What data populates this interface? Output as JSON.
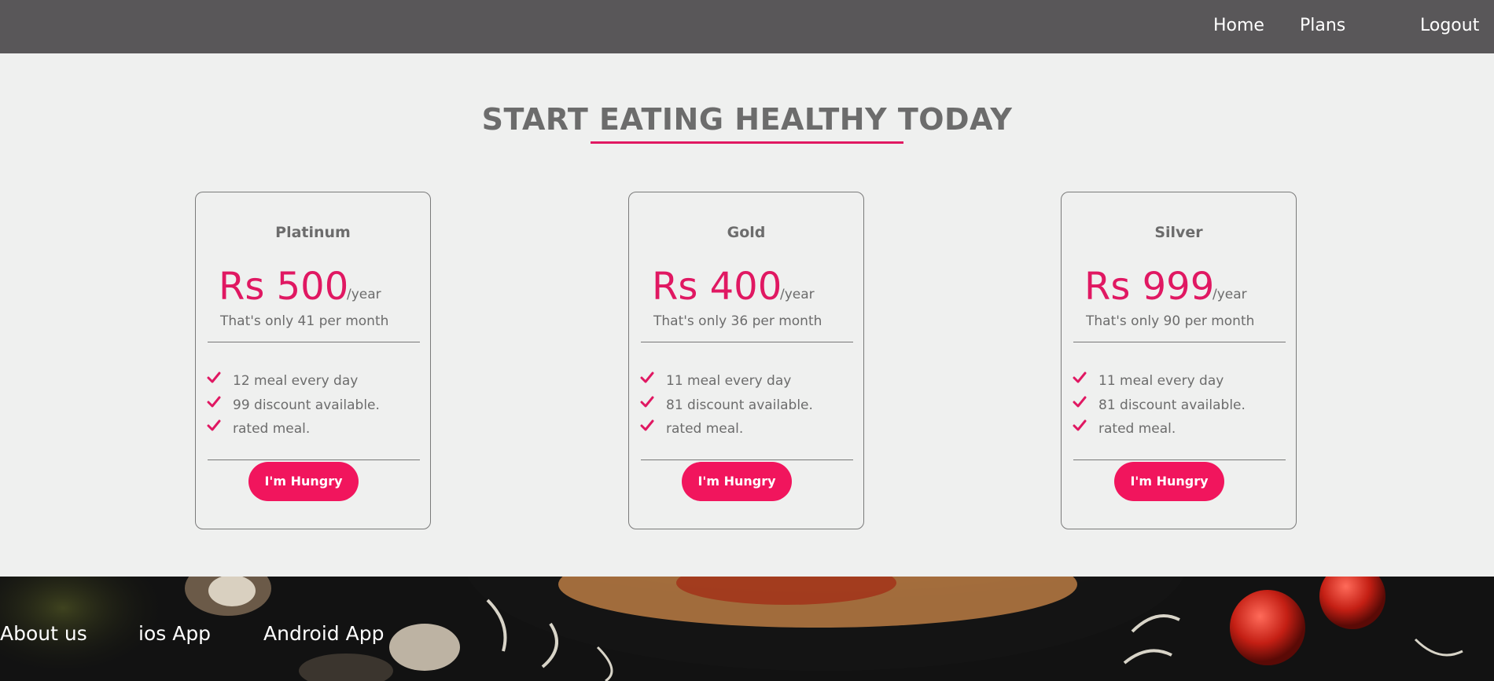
{
  "nav": {
    "links": [
      "Home",
      "Plans",
      "Logout"
    ]
  },
  "hero": {
    "title": "START EATING HEALTHY TODAY"
  },
  "plans": [
    {
      "name": "Platinum",
      "price": "Rs 500",
      "period": "/year",
      "note": "That's only 41 per month",
      "features": [
        "12 meal every day",
        "99 discount available.",
        "rated meal."
      ],
      "button": "I'm Hungry"
    },
    {
      "name": "Gold",
      "price": "Rs 400",
      "period": "/year",
      "note": "That's only 36 per month",
      "features": [
        "11 meal every day",
        "81 discount available.",
        "rated meal."
      ],
      "button": "I'm Hungry"
    },
    {
      "name": "Silver",
      "price": "Rs 999",
      "period": "/year",
      "note": "That's only 90 per month",
      "features": [
        "11 meal every day",
        "81 discount available.",
        "rated meal."
      ],
      "button": "I'm Hungry"
    }
  ],
  "footer": {
    "links": [
      "About us",
      "ios App",
      "Android App"
    ]
  },
  "colors": {
    "accent": "#f1155d",
    "nav_bg": "#595759",
    "page_bg": "#eff0ef",
    "text_gray": "#6c6c6c"
  },
  "icons": {
    "feature_check": "check-icon"
  }
}
